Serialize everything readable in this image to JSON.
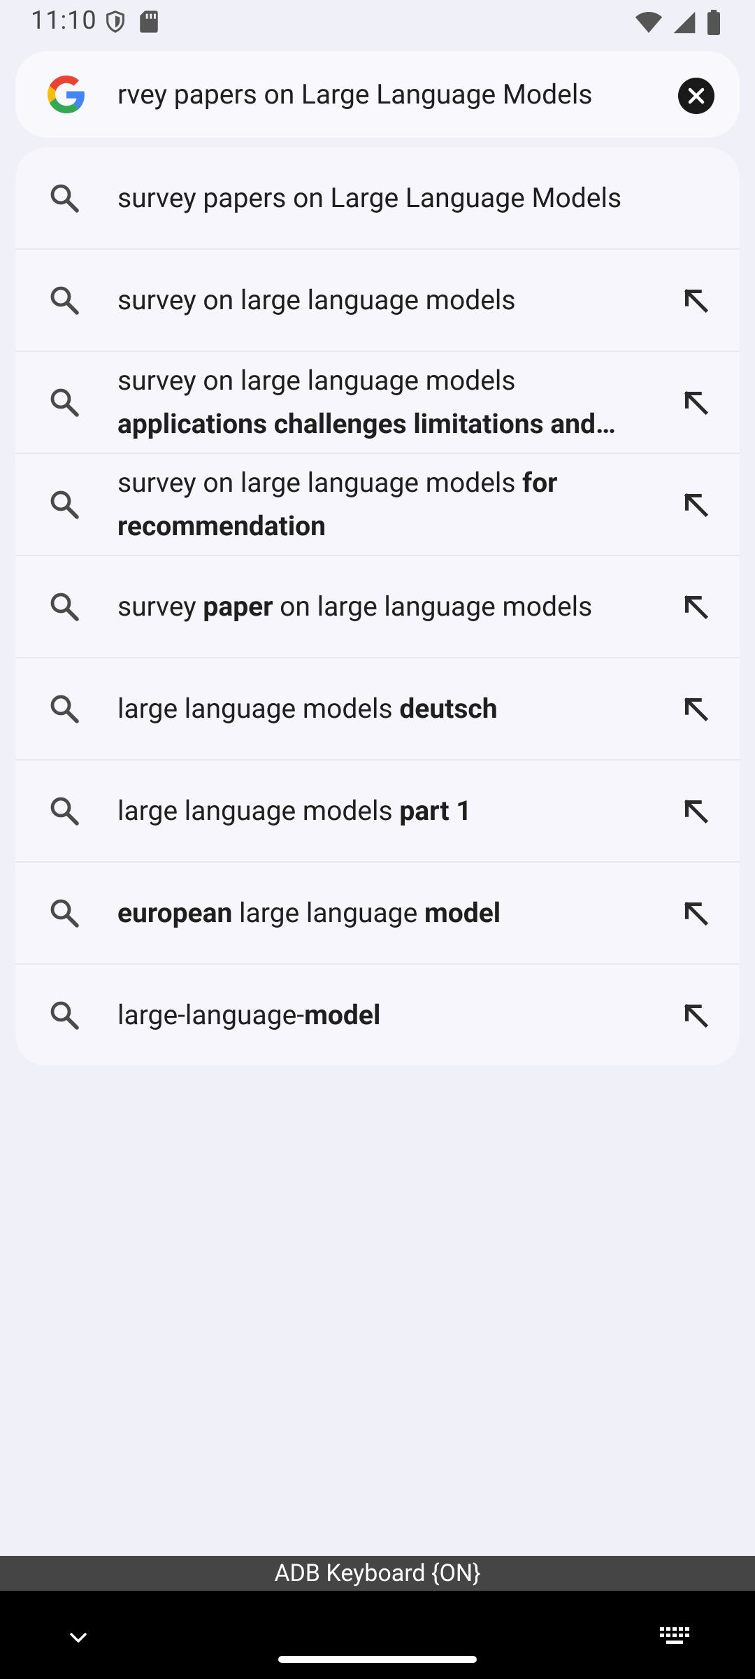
{
  "status": {
    "time": "11:10"
  },
  "search": {
    "query": "rvey papers on Large Language Models"
  },
  "suggestions": [
    {
      "lines": [
        [
          [
            "survey papers on Large Language Models",
            false
          ]
        ]
      ],
      "fill_arrow": false
    },
    {
      "lines": [
        [
          [
            "survey on large language models",
            false
          ]
        ]
      ],
      "fill_arrow": true
    },
    {
      "lines": [
        [
          [
            "survey on large language models",
            false
          ]
        ],
        [
          [
            "applications challenges limitations and…",
            true
          ]
        ]
      ],
      "fill_arrow": true
    },
    {
      "lines": [
        [
          [
            "survey on large language models ",
            false
          ],
          [
            "for",
            true
          ]
        ],
        [
          [
            "recommendation",
            true
          ]
        ]
      ],
      "fill_arrow": true
    },
    {
      "lines": [
        [
          [
            "survey ",
            false
          ],
          [
            "paper",
            true
          ],
          [
            " on large language models",
            false
          ]
        ]
      ],
      "fill_arrow": true
    },
    {
      "lines": [
        [
          [
            "large language models ",
            false
          ],
          [
            "deutsch",
            true
          ]
        ]
      ],
      "fill_arrow": true
    },
    {
      "lines": [
        [
          [
            "large language models ",
            false
          ],
          [
            "part 1",
            true
          ]
        ]
      ],
      "fill_arrow": true
    },
    {
      "lines": [
        [
          [
            "european",
            true
          ],
          [
            " large language ",
            false
          ],
          [
            "model",
            true
          ]
        ]
      ],
      "fill_arrow": true
    },
    {
      "lines": [
        [
          [
            "large-language-",
            false
          ],
          [
            "model",
            true
          ]
        ]
      ],
      "fill_arrow": true
    }
  ],
  "keyboard": {
    "label": "ADB Keyboard {ON}"
  },
  "colors": {
    "background": "#f0f0f8",
    "card": "#f6f6fc",
    "icon": "#4a4a4a"
  }
}
